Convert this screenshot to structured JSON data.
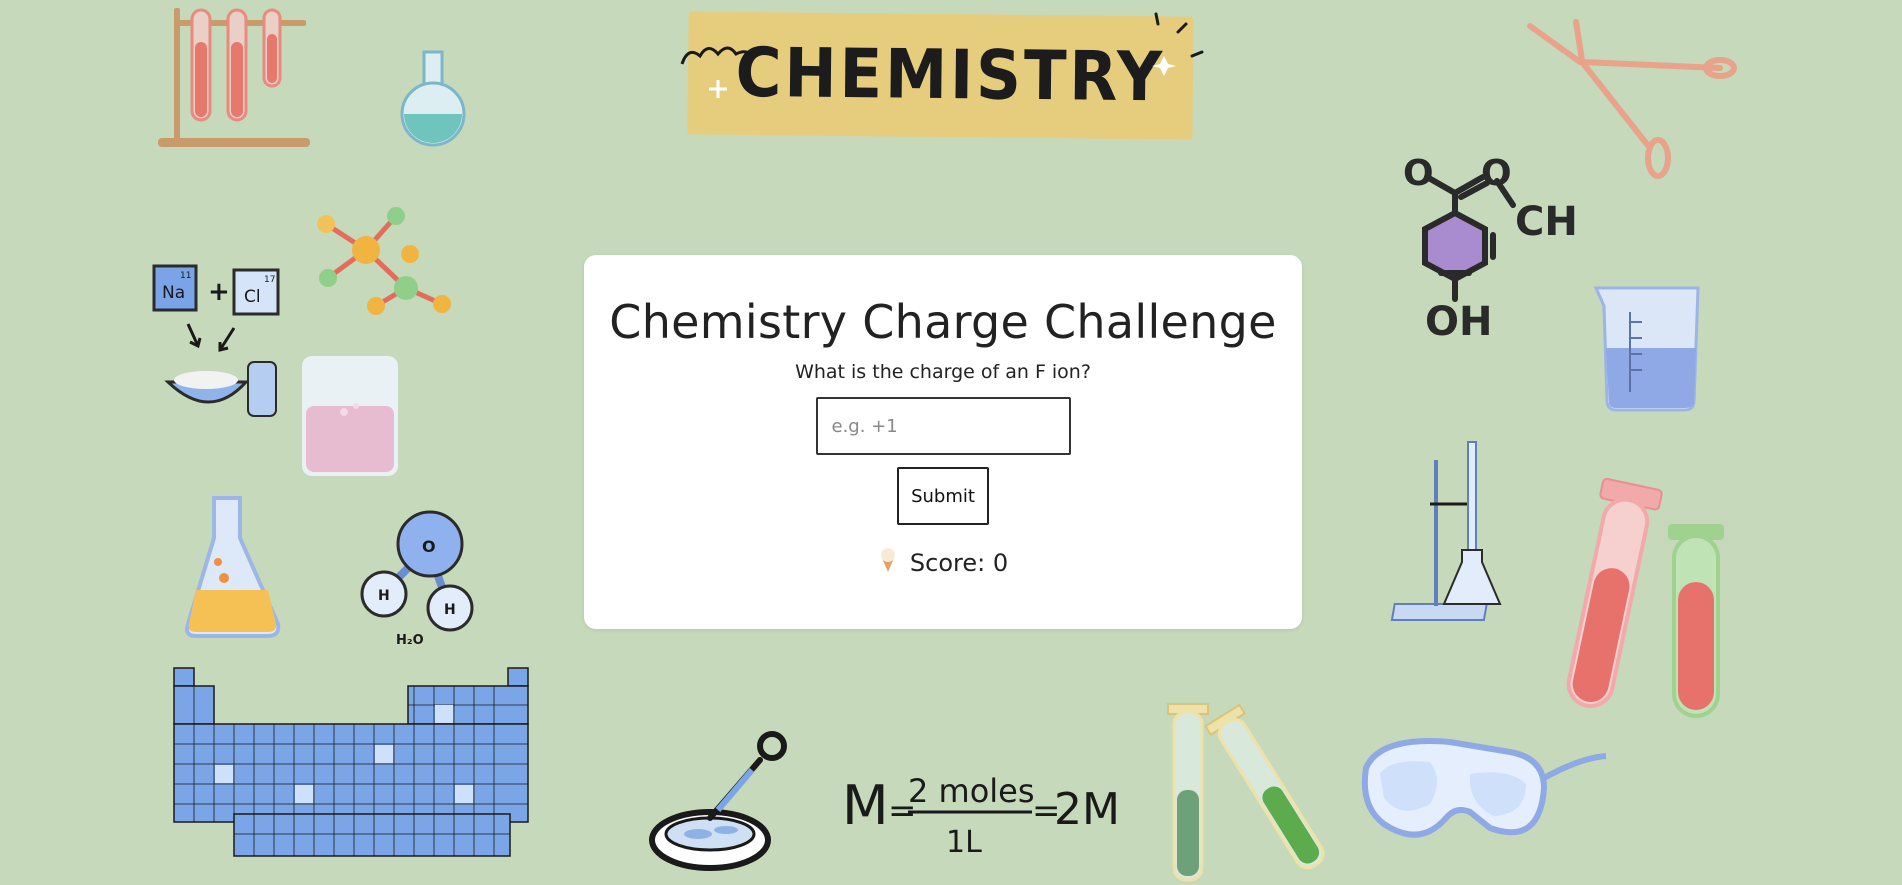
{
  "banner": {
    "title": "CHEMISTRY"
  },
  "quiz": {
    "title": "Chemistry Charge Challenge",
    "question": "What is the charge of an F ion?",
    "answer_placeholder": "e.g. +1",
    "answer_value": "",
    "submit_label": "Submit",
    "score_label": "Score: 0",
    "score_icon": "ice-cream-icon"
  },
  "decorations": {
    "sodium_label": "Na",
    "sodium_number": "11",
    "chlorine_label": "Cl",
    "chlorine_number": "17",
    "water_oxygen": "O",
    "water_hydrogen": "H",
    "water_formula": "H₂O",
    "molecule_oxygen": "O",
    "molecule_ch": "CH",
    "molecule_oh": "OH",
    "formula_left": "M",
    "formula_numerator": "2 moles",
    "formula_denominator": "1L",
    "formula_result": "2M"
  },
  "colors": {
    "background": "#c6d9bb",
    "banner": "#e6cd7d",
    "card": "#ffffff"
  }
}
